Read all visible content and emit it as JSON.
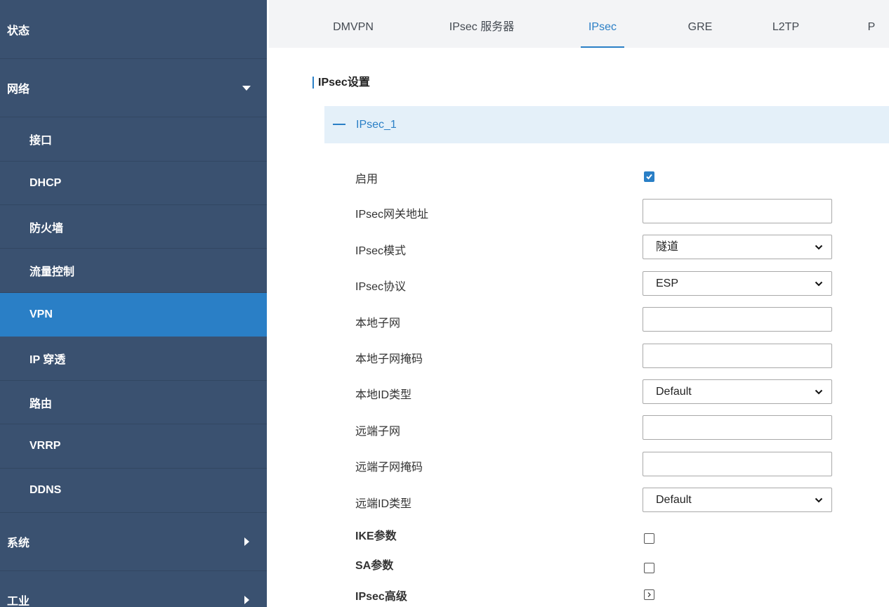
{
  "sidebar": {
    "items": [
      {
        "label": "状态",
        "level": "top",
        "state": "normal"
      },
      {
        "label": "网络",
        "level": "top",
        "state": "expanded"
      },
      {
        "label": "接口",
        "level": "sub",
        "state": "normal"
      },
      {
        "label": "DHCP",
        "level": "sub",
        "state": "normal"
      },
      {
        "label": "防火墙",
        "level": "sub",
        "state": "normal"
      },
      {
        "label": "流量控制",
        "level": "sub",
        "state": "normal"
      },
      {
        "label": "VPN",
        "level": "sub",
        "state": "active"
      },
      {
        "label": "IP 穿透",
        "level": "sub",
        "state": "normal"
      },
      {
        "label": "路由",
        "level": "sub",
        "state": "normal"
      },
      {
        "label": "VRRP",
        "level": "sub",
        "state": "normal"
      },
      {
        "label": "DDNS",
        "level": "sub",
        "state": "normal"
      },
      {
        "label": "系统",
        "level": "top",
        "state": "collapsed"
      },
      {
        "label": "工业",
        "level": "top",
        "state": "collapsed"
      }
    ]
  },
  "tabs": [
    {
      "label": "DMVPN",
      "active": false
    },
    {
      "label": "IPsec 服务器",
      "active": false
    },
    {
      "label": "IPsec",
      "active": true
    },
    {
      "label": "GRE",
      "active": false
    },
    {
      "label": "L2TP",
      "active": false
    },
    {
      "label": "P",
      "active": false
    }
  ],
  "section_title": "IPsec设置",
  "panel": {
    "title": "IPsec_1",
    "fields": {
      "enable": {
        "label": "启用",
        "checked": true
      },
      "gateway": {
        "label": "IPsec网关地址",
        "value": ""
      },
      "mode": {
        "label": "IPsec模式",
        "value": "隧道"
      },
      "protocol": {
        "label": "IPsec协议",
        "value": "ESP"
      },
      "local_subnet": {
        "label": "本地子网",
        "value": ""
      },
      "local_mask": {
        "label": "本地子网掩码",
        "value": ""
      },
      "local_id_type": {
        "label": "本地ID类型",
        "value": "Default"
      },
      "remote_subnet": {
        "label": "远端子网",
        "value": ""
      },
      "remote_mask": {
        "label": "远端子网掩码",
        "value": ""
      },
      "remote_id_type": {
        "label": "远端ID类型",
        "value": "Default"
      },
      "ike": {
        "label": "IKE参数",
        "checked": false
      },
      "sa": {
        "label": "SA参数",
        "checked": false
      },
      "advanced": {
        "label": "IPsec高级",
        "expanded": false
      }
    }
  },
  "colors": {
    "sidebar_bg": "#3a5170",
    "active_accent": "#2a7fc6",
    "panel_header_bg": "#e4f0f9"
  }
}
